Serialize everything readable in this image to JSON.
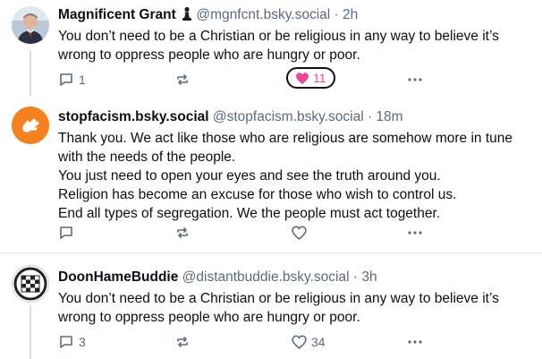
{
  "posts": [
    {
      "name": "Magnificent Grant",
      "badge_icon": "chess-pawn-icon",
      "handle": "@mgnfcnt.bsky.social",
      "time": "· 2h",
      "text": [
        "You don’t need to be a Christian or be religious in any way to believe it’s wrong to oppress people who are hungry or poor."
      ],
      "replies": "1",
      "reposts": "",
      "likes": "11",
      "liked": true
    },
    {
      "name": "stopfacism.bsky.social",
      "handle": "@stopfacism.bsky.social",
      "time": "· 18m",
      "text": [
        "Thank you. We act like those who are religious are somehow more in tune with the needs of the people.",
        "You just need to open your eyes and see the truth around you.",
        "Religion has become an excuse for those who wish to control us.",
        "End all types of segregation. We the people must act together."
      ],
      "replies": "",
      "reposts": "",
      "likes": "",
      "liked": false,
      "avatar_color": "#f4801f"
    },
    {
      "name": "DoonHameBuddie",
      "handle": "@distantbuddie.bsky.social",
      "time": "· 3h",
      "text": [
        "You don’t need to be a Christian or be religious in any way to believe it’s wrong to oppress people who are hungry or poor."
      ],
      "replies": "3",
      "reposts": "",
      "likes": "34",
      "liked": false
    }
  ],
  "colors": {
    "like_pink": "#ec4899",
    "icon_gray": "#5b6b7e",
    "handle_gray": "#5c6a79"
  }
}
